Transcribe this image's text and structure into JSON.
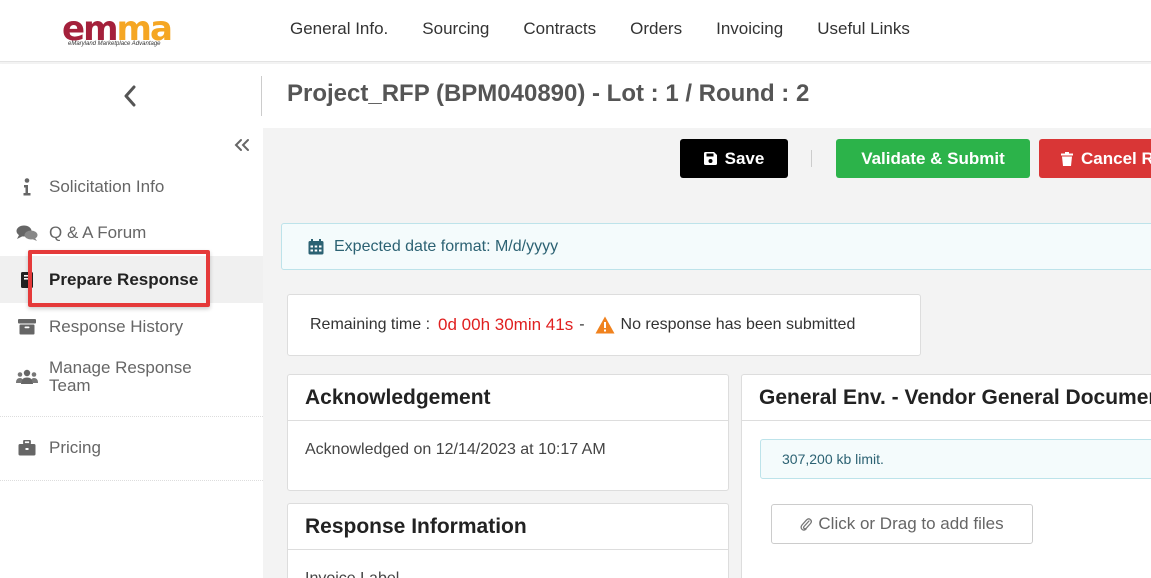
{
  "logo": {
    "letters": [
      "e",
      "m",
      "m",
      "a"
    ],
    "tagline": "eMaryland Marketplace Advantage",
    "colors": {
      "red": "#a4203b",
      "gold": "#f5a623"
    }
  },
  "nav": {
    "items": [
      {
        "label": "General Info."
      },
      {
        "label": "Sourcing"
      },
      {
        "label": "Contracts"
      },
      {
        "label": "Orders"
      },
      {
        "label": "Invoicing"
      },
      {
        "label": "Useful Links"
      }
    ]
  },
  "header": {
    "back_icon": "chevron-left-icon",
    "title": "Project_RFP (BPM040890) - Lot : 1 / Round : 2"
  },
  "sidebar": {
    "collapse_icon": "double-chevron-left-icon",
    "items": [
      {
        "label": "Solicitation Info",
        "icon": "info-icon"
      },
      {
        "label": "Q & A Forum",
        "icon": "comments-icon"
      },
      {
        "label": "Prepare Response",
        "icon": "book-icon",
        "active": true
      },
      {
        "label": "Response History",
        "icon": "archive-icon"
      },
      {
        "label": "Manage Response Team",
        "icon": "users-icon"
      },
      {
        "label": "Pricing",
        "icon": "briefcase-icon"
      }
    ]
  },
  "toolbar": {
    "save_label": "Save",
    "validate_label": "Validate & Submit",
    "cancel_label": "Cancel R"
  },
  "date_notice": {
    "text": "Expected date format: M/d/yyyy"
  },
  "remaining": {
    "label": "Remaining time :",
    "timer": "0d 00h 30min 41s",
    "dash": "-",
    "status": "No response has been submitted"
  },
  "acknowledgement": {
    "title": "Acknowledgement",
    "text": "Acknowledged on 12/14/2023 at 10:17 AM"
  },
  "response_info": {
    "title": "Response Information",
    "partial_label": "Invoice Label"
  },
  "general_env": {
    "title": "General Env. - Vendor General Documen",
    "limit": "307,200 kb limit.",
    "add_files": "Click or Drag to add files"
  },
  "colors": {
    "save": "#000000",
    "validate": "#2cb34a",
    "cancel": "#d93636",
    "timer": "#e02020",
    "highlight": "#e53a3a"
  }
}
